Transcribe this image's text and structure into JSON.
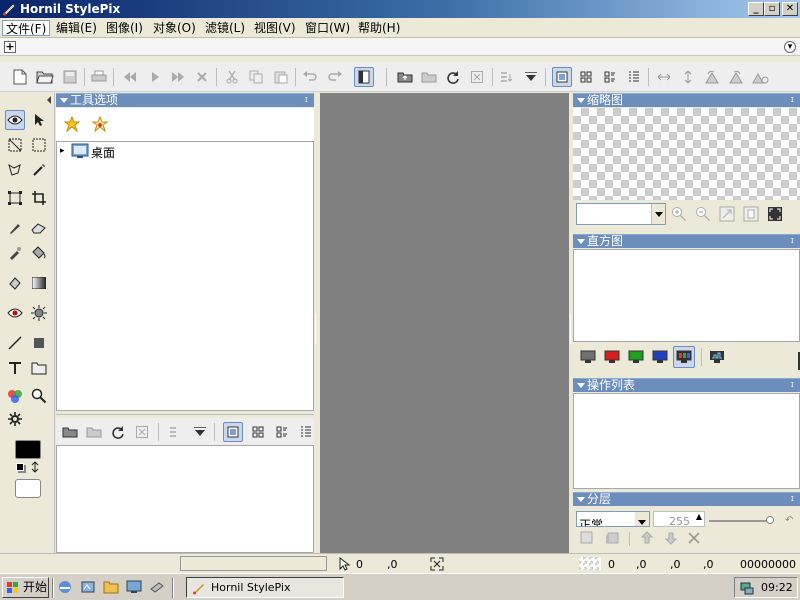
{
  "window": {
    "title": "Hornil StylePix",
    "btn_min": "_",
    "btn_max": "▫",
    "btn_close": "✕"
  },
  "menu": {
    "items": [
      "文件(F)",
      "编辑(E)",
      "图像(I)",
      "对象(O)",
      "滤镜(L)",
      "视图(V)",
      "窗口(W)",
      "帮助(H)"
    ]
  },
  "nav": {
    "add_symbol": "+",
    "dropdown_symbol": "▾"
  },
  "left_panel": {
    "tool_options_title": "工具选项",
    "tree_root_label": "桌面",
    "tree_expander": "▸"
  },
  "navigator": {
    "title": "缩略图",
    "zoom_value": ""
  },
  "histogram": {
    "title": "直方图",
    "channel_colors": [
      "#707070",
      "#d02020",
      "#20a020",
      "#2040c0",
      "#303030"
    ]
  },
  "history": {
    "title": "操作列表"
  },
  "layers": {
    "title": "分层",
    "blend_mode": "正常",
    "opacity": "255"
  },
  "status": {
    "cursor_x": "0",
    "cursor_y": ",0",
    "sel_x": "0",
    "sel_y": ",0",
    "sel_w": ",0",
    "sel_h": ",0",
    "color": "00000000"
  },
  "taskbar": {
    "start_label": "开始",
    "task_label": "Hornil StylePix",
    "clock": "09:22"
  },
  "colors": {
    "accent": "#6c8ebd",
    "canvas": "#808080",
    "title_dark": "#0a246a"
  }
}
